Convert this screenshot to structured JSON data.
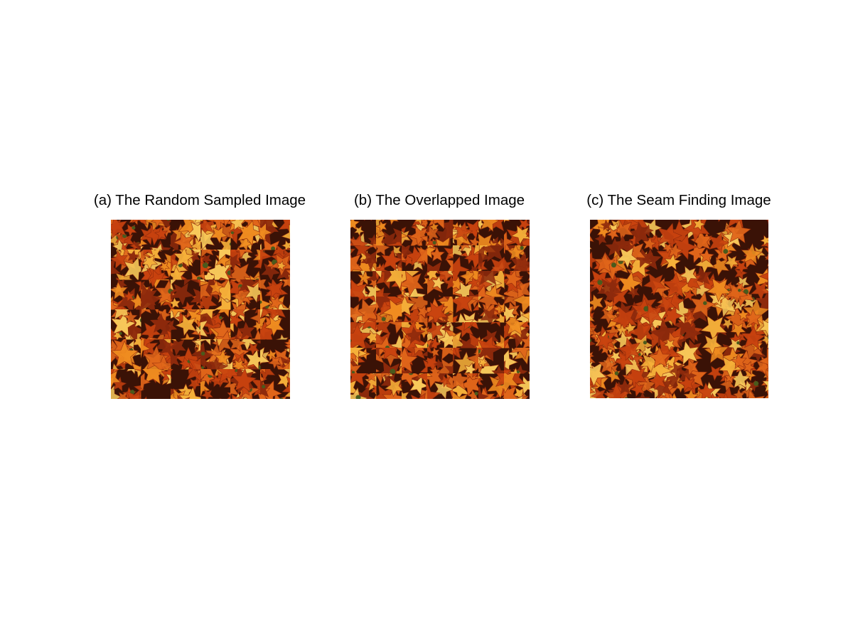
{
  "panels": [
    {
      "title": "(a) The Random Sampled Image",
      "mode": "random",
      "seed": 11
    },
    {
      "title": "(b) The Overlapped Image",
      "mode": "overlap",
      "seed": 29
    },
    {
      "title": "(c) The Seam Finding Image",
      "mode": "seam",
      "seed": 47
    }
  ],
  "palette": {
    "dark": "#3a1206",
    "deep_red": "#8e2a0c",
    "red_orange": "#c8420f",
    "orange": "#e0651a",
    "amber": "#f08c20",
    "yellow": "#f6b13a",
    "pale_yellow": "#f8c95a",
    "green_fleck": "#4a5a1c"
  }
}
